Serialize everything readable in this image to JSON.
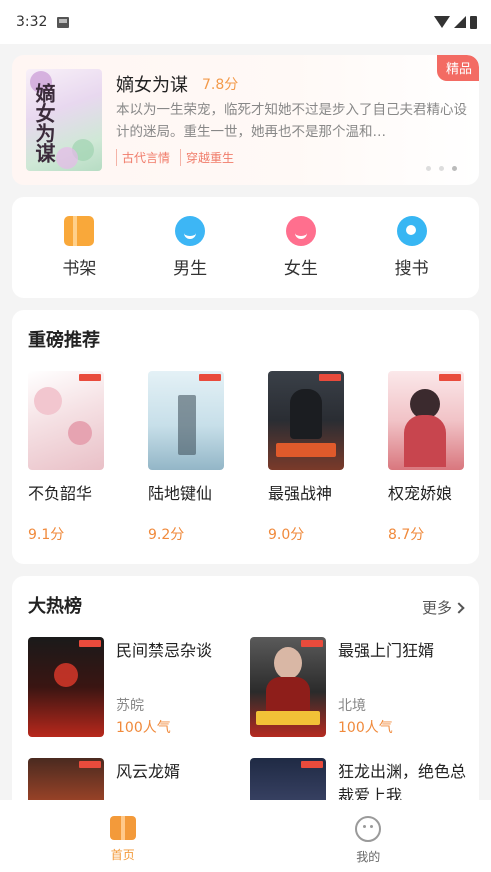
{
  "status": {
    "time": "3:32"
  },
  "banner": {
    "badge": "精品",
    "title": "嫡女为谋",
    "score": "7.8分",
    "description": "本以为一生荣宠，临死才知她不过是步入了自己夫君精心设计的迷局。重生一世，她再也不是那个温和…",
    "tags": [
      "古代言情",
      "穿越重生"
    ],
    "cover_title": "嫡女为谋"
  },
  "nav": [
    {
      "label": "书架",
      "icon": "bookshelf-icon"
    },
    {
      "label": "男生",
      "icon": "boy-icon"
    },
    {
      "label": "女生",
      "icon": "girl-icon"
    },
    {
      "label": "搜书",
      "icon": "search-book-icon"
    }
  ],
  "recommend": {
    "title": "重磅推荐",
    "books": [
      {
        "name": "不负韶华",
        "score": "9.1分"
      },
      {
        "name": "陆地键仙",
        "score": "9.2分"
      },
      {
        "name": "最强战神",
        "score": "9.0分"
      },
      {
        "name": "权宠娇娘",
        "score": "8.7分"
      }
    ]
  },
  "hot": {
    "title": "大热榜",
    "more": "更多",
    "items": [
      {
        "name": "民间禁忌杂谈",
        "author": "苏皖",
        "popularity": "100人气"
      },
      {
        "name": "最强上门狂婿",
        "author": "北境",
        "popularity": "100人气"
      },
      {
        "name": "风云龙婿",
        "author": "",
        "popularity": ""
      },
      {
        "name": "狂龙出渊，绝色总裁爱上我",
        "author": "",
        "popularity": ""
      }
    ]
  },
  "tabs": [
    {
      "label": "首页",
      "active": true
    },
    {
      "label": "我的",
      "active": false
    }
  ],
  "colors": {
    "accent": "#f39a3a",
    "score": "#f08a3c",
    "badge": "#f36b63"
  }
}
